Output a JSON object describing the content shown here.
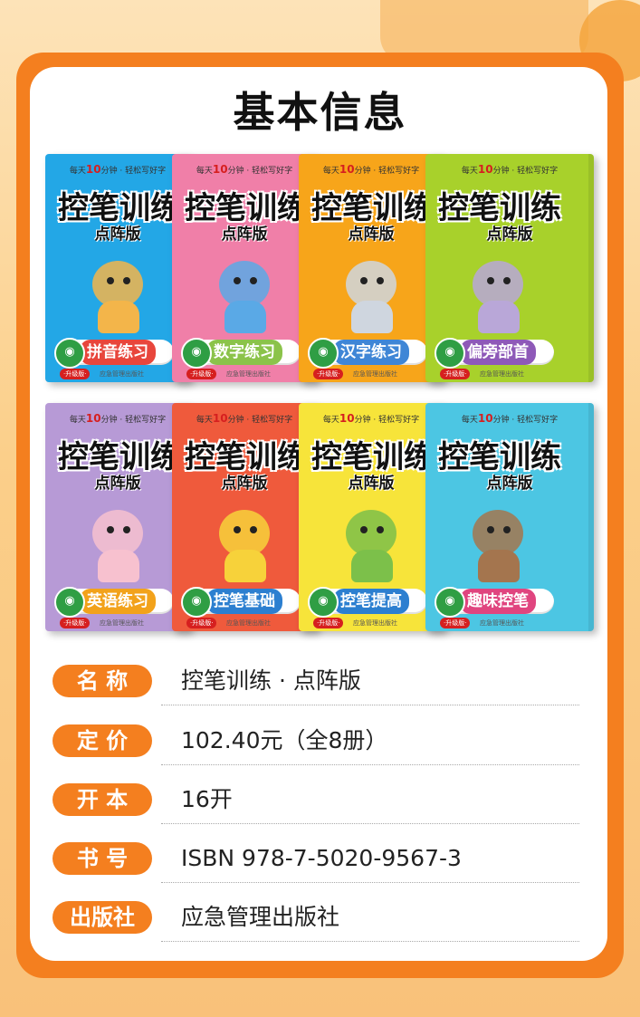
{
  "header": {
    "title": "基本信息"
  },
  "books": [
    {
      "tagline_pre": "每天",
      "tagline_num": "10",
      "tagline_post": "分钟 · 轻松写好字",
      "title": "控笔训练",
      "edition": "点阵版",
      "label": "拼音练习",
      "upgrade": "·升级版·",
      "publisher": "应急管理出版社",
      "bg": "#23a7e6",
      "label_bg": "#e8463c",
      "art": "#f3b54a"
    },
    {
      "tagline_pre": "每天",
      "tagline_num": "10",
      "tagline_post": "分钟 · 轻松写好字",
      "title": "控笔训练",
      "edition": "点阵版",
      "label": "数字练习",
      "upgrade": "·升级版·",
      "publisher": "应急管理出版社",
      "bg": "#f07fa8",
      "label_bg": "#8bc34a",
      "art": "#5aa9e6"
    },
    {
      "tagline_pre": "每天",
      "tagline_num": "10",
      "tagline_post": "分钟 · 轻松写好字",
      "title": "控笔训练",
      "edition": "点阵版",
      "label": "汉字练习",
      "upgrade": "·升级版·",
      "publisher": "应急管理出版社",
      "bg": "#f7a51a",
      "label_bg": "#3f86d6",
      "art": "#cfd6df"
    },
    {
      "tagline_pre": "每天",
      "tagline_num": "10",
      "tagline_post": "分钟 · 轻松写好字",
      "title": "控笔训练",
      "edition": "点阵版",
      "label": "偏旁部首",
      "upgrade": "·升级版·",
      "publisher": "应急管理出版社",
      "bg": "#a8d12b",
      "label_bg": "#8e59b8",
      "art": "#b9a7d8"
    },
    {
      "tagline_pre": "每天",
      "tagline_num": "10",
      "tagline_post": "分钟 · 轻松写好字",
      "title": "控笔训练",
      "edition": "点阵版",
      "label": "英语练习",
      "upgrade": "·升级版·",
      "publisher": "应急管理出版社",
      "bg": "#b79ad6",
      "label_bg": "#f2a21b",
      "art": "#f7c1cf"
    },
    {
      "tagline_pre": "每天",
      "tagline_num": "10",
      "tagline_post": "分钟 · 轻松写好字",
      "title": "控笔训练",
      "edition": "点阵版",
      "label": "控笔基础",
      "upgrade": "·升级版·",
      "publisher": "应急管理出版社",
      "bg": "#ef5a3c",
      "label_bg": "#2c7fd0",
      "art": "#f7d23a"
    },
    {
      "tagline_pre": "每天",
      "tagline_num": "10",
      "tagline_post": "分钟 · 轻松写好字",
      "title": "控笔训练",
      "edition": "点阵版",
      "label": "控笔提高",
      "upgrade": "·升级版·",
      "publisher": "应急管理出版社",
      "bg": "#f7e43a",
      "label_bg": "#2c7fd0",
      "art": "#7cc04a"
    },
    {
      "tagline_pre": "每天",
      "tagline_num": "10",
      "tagline_post": "分钟 · 轻松写好字",
      "title": "控笔训练",
      "edition": "点阵版",
      "label": "趣味控笔",
      "upgrade": "·升级版·",
      "publisher": "应急管理出版社",
      "bg": "#4cc6e3",
      "label_bg": "#e0457f",
      "art": "#a4754e"
    }
  ],
  "info": [
    {
      "key": "名 称",
      "value": "控笔训练 · 点阵版"
    },
    {
      "key": "定 价",
      "value": "102.40元（全8册）"
    },
    {
      "key": "开 本",
      "value": "16开"
    },
    {
      "key": "书 号",
      "value": "ISBN 978-7-5020-9567-3"
    },
    {
      "key": "出版社",
      "value": "应急管理出版社"
    }
  ],
  "colors": {
    "accent": "#f47f1f",
    "card": "#ffffff"
  }
}
